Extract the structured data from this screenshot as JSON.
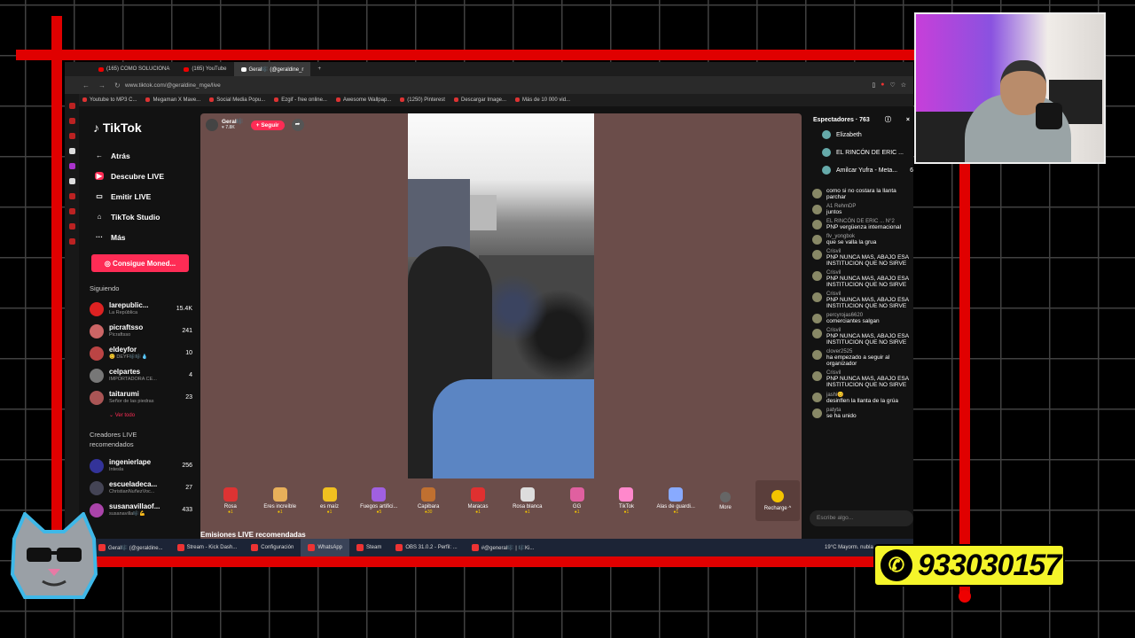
{
  "browser": {
    "tabs": [
      {
        "label": "(165) COMO SOLUCIONA",
        "active": false
      },
      {
        "label": "(165) YouTube",
        "active": false
      },
      {
        "label": "Geral🎼 (@geraldine_r",
        "active": true
      }
    ],
    "url": "www.tiktok.com/@geraldine_mge/live",
    "bookmarks": [
      "Youtube to MP3 C...",
      "Megaman X Mave...",
      "Social Media Popu...",
      "Ezgif - free online...",
      "Awesome Wallpap...",
      "(1250) Pinterest",
      "Descargar Image...",
      "Más de 10 000 vid..."
    ]
  },
  "sidebar": {
    "logo": "TikTok",
    "nav": [
      {
        "label": "Atrás",
        "icon": "arrow-left-icon"
      },
      {
        "label": "Descubre LIVE",
        "icon": "live-icon"
      },
      {
        "label": "Emitir LIVE",
        "icon": "camera-icon"
      },
      {
        "label": "TikTok Studio",
        "icon": "home-icon"
      },
      {
        "label": "Más",
        "icon": "more-icon"
      }
    ],
    "coins_button": "Consigue Moned...",
    "following_title": "Siguiendo",
    "following": [
      {
        "name": "larepublic...",
        "sub": "La República",
        "count": "15.4K",
        "color": "#d22"
      },
      {
        "name": "picraftsso",
        "sub": "Picraftsso",
        "count": "241",
        "color": "#c66"
      },
      {
        "name": "eldeyfor",
        "sub": "😊 DEYF🎼🎼💧",
        "count": "10",
        "color": "#b44"
      },
      {
        "name": "celpartes",
        "sub": "IMPORTADORA CE...",
        "count": "4",
        "color": "#777"
      },
      {
        "name": "taitarumi",
        "sub": "Señor de las piedras",
        "count": "23",
        "color": "#a55"
      }
    ],
    "see_all": "Ver todo",
    "recommended_title": "Creadores LIVE recomendados",
    "recommended": [
      {
        "name": "ingenierlape",
        "sub": "Intesla",
        "count": "256",
        "color": "#339"
      },
      {
        "name": "escueladeca...",
        "sub": "ChristianNuñezVoc...",
        "count": "27",
        "color": "#445"
      },
      {
        "name": "susanavillaof...",
        "sub": "susanavilla🎼💪",
        "count": "433",
        "color": "#a4a"
      }
    ]
  },
  "live": {
    "streamer_name": "Geral🎼",
    "streamer_likes": "♥ 7.8K",
    "follow_button": "+ Seguir",
    "gifts": [
      {
        "name": "Rosa",
        "cost": "●1",
        "color": "#d33"
      },
      {
        "name": "Eres increíble",
        "cost": "●1",
        "color": "#e8b05a"
      },
      {
        "name": "es maíz",
        "cost": "●1",
        "color": "#f0c020"
      },
      {
        "name": "Fuegos artifici...",
        "cost": "●5",
        "color": "#a060e0"
      },
      {
        "name": "Capibara",
        "cost": "●30",
        "color": "#c07030"
      },
      {
        "name": "Maracas",
        "cost": "●1",
        "color": "#e03030"
      },
      {
        "name": "Rosa blanca",
        "cost": "●1",
        "color": "#ddd"
      },
      {
        "name": "GG",
        "cost": "●1",
        "color": "#e060a0"
      },
      {
        "name": "TikTok",
        "cost": "●1",
        "color": "#ff88cc"
      },
      {
        "name": "Alas de guardi...",
        "cost": "●1",
        "color": "#88aaff"
      },
      {
        "name": "More",
        "cost": "",
        "color": "#666"
      }
    ],
    "recharge": "Recharge ^",
    "recommended_lives": "Emisiones LIVE recomendadas"
  },
  "chat": {
    "viewers_title": "Espectadores · 763",
    "top_viewers": [
      {
        "name": "Elizabeth",
        "rank": ""
      },
      {
        "name": "EL RINCÓN DE ERIC ...",
        "rank": ""
      },
      {
        "name": "Amilcar Yufra - Meta...",
        "rank": "6"
      }
    ],
    "messages": [
      {
        "user": "",
        "text": "como si no costara la llanta parchar"
      },
      {
        "user": "A1 RehmDP",
        "text": "juntos"
      },
      {
        "user": "EL RINCÓN DE ERIC ... N°2",
        "text": "PNP vergüenza internacional"
      },
      {
        "user": "flv_yongbok",
        "text": "que se valla la grua"
      },
      {
        "user": "Crisvil",
        "text": "PNP NUNCA MAS, ABAJO ESA INSTITUCION QUE NO SIRVE"
      },
      {
        "user": "Crisvil",
        "text": "PNP NUNCA MAS, ABAJO ESA INSTITUCION QUE NO SIRVE"
      },
      {
        "user": "Crisvil",
        "text": "PNP NUNCA MAS, ABAJO ESA INSTITUCION QUE NO SIRVE"
      },
      {
        "user": "percyrojas6620",
        "text": "comerciantes salgan"
      },
      {
        "user": "Crisvil",
        "text": "PNP NUNCA MAS, ABAJO ESA INSTITUCION QUE NO SIRVE"
      },
      {
        "user": "clover2525",
        "text": "ha empezado a seguir al organizador"
      },
      {
        "user": "Crisvil",
        "text": "PNP NUNCA MAS, ABAJO ESA INSTITUCION QUE NO SIRVE"
      },
      {
        "user": "jashi😊",
        "text": "desinflen la llanta de la grúa"
      },
      {
        "user": "patyta",
        "text": "se ha unido"
      }
    ],
    "input_placeholder": "Escribe algo..."
  },
  "taskbar": {
    "items": [
      {
        "label": "Geral🎼 (@geraldine...",
        "active": false
      },
      {
        "label": "Stream - Kick Dash...",
        "active": false
      },
      {
        "label": "Configuración",
        "active": false
      },
      {
        "label": "WhatsApp",
        "active": true
      },
      {
        "label": "Steam",
        "active": false
      },
      {
        "label": "OBS 31.0.2 - Perfil: ...",
        "active": false
      },
      {
        "label": "#@general🎼 | 🎼Ki...",
        "active": false
      }
    ],
    "weather": "19°C  Mayorm. nubla..."
  },
  "overlay": {
    "phone": "933030157"
  },
  "colors": {
    "accent": "#fe2c55",
    "frame": "#e00000",
    "phone_bg": "#f5f52a"
  }
}
